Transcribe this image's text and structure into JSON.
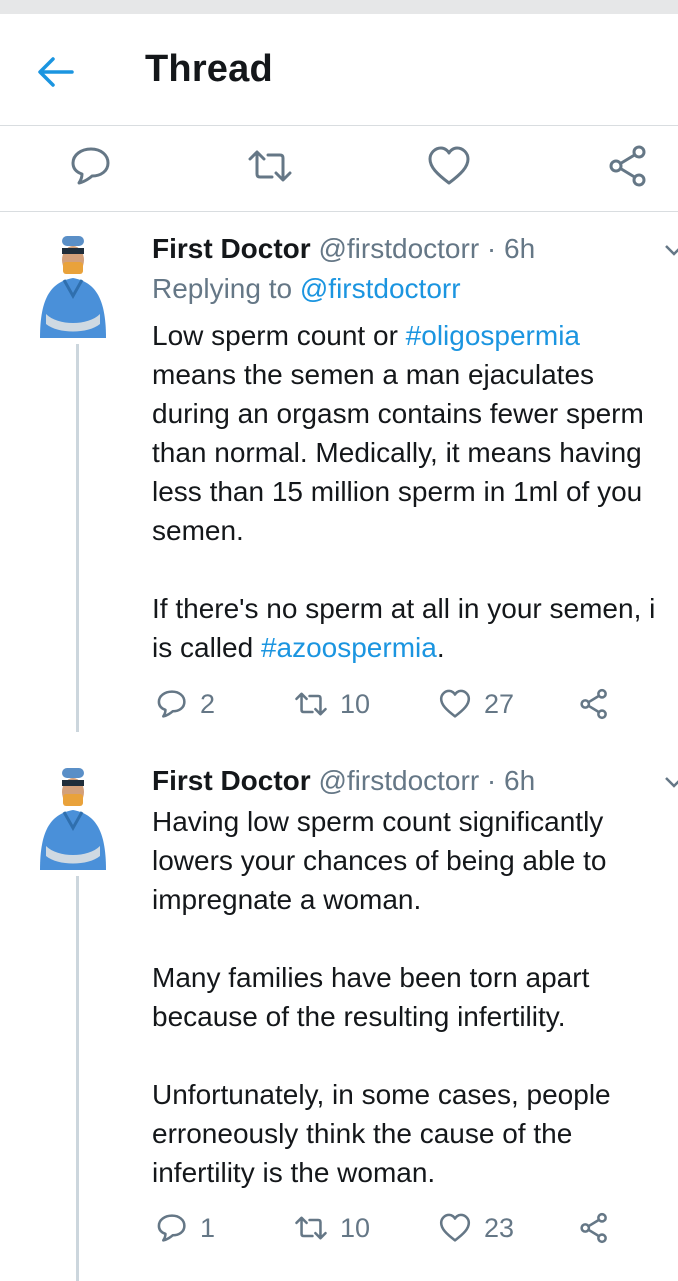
{
  "header": {
    "title": "Thread"
  },
  "icons": {
    "back": "arrow-left-icon",
    "reply": "reply-icon",
    "retweet": "retweet-icon",
    "like": "heart-icon",
    "share": "share-icon"
  },
  "colors": {
    "accent": "#1b95e0",
    "muted": "#657786",
    "text": "#14171a",
    "divider": "#d9dde0"
  },
  "tweets": [
    {
      "name": "First Doctor",
      "handle": "@firstdoctorr",
      "sep": " · ",
      "time": "6h",
      "replying_prefix": "Replying to ",
      "replying_to": "@firstdoctorr",
      "text_1": "Low sperm count or ",
      "hashtag_1": "#oligospermia",
      "text_2": "\nmeans the semen a man ejaculates\nduring an orgasm contains fewer sperm\nthan normal. Medically, it means having\nless than 15 million sperm in 1ml of you\nsemen.\n\nIf there's no sperm at all in your semen, i\nis called ",
      "hashtag_2": "#azoospermia",
      "text_3": ".",
      "replies": "2",
      "retweets": "10",
      "likes": "27"
    },
    {
      "name": "First Doctor",
      "handle": "@firstdoctorr",
      "sep": " · ",
      "time": "6h",
      "text": "Having low sperm count significantly\nlowers your chances of being able to\nimpregnate a woman.\n\nMany families have been torn apart\nbecause of the resulting infertility.\n\nUnfortunately, in some cases, people\nerroneously think the cause of the\ninfertility is the woman.",
      "replies": "1",
      "retweets": "10",
      "likes": "23"
    }
  ]
}
